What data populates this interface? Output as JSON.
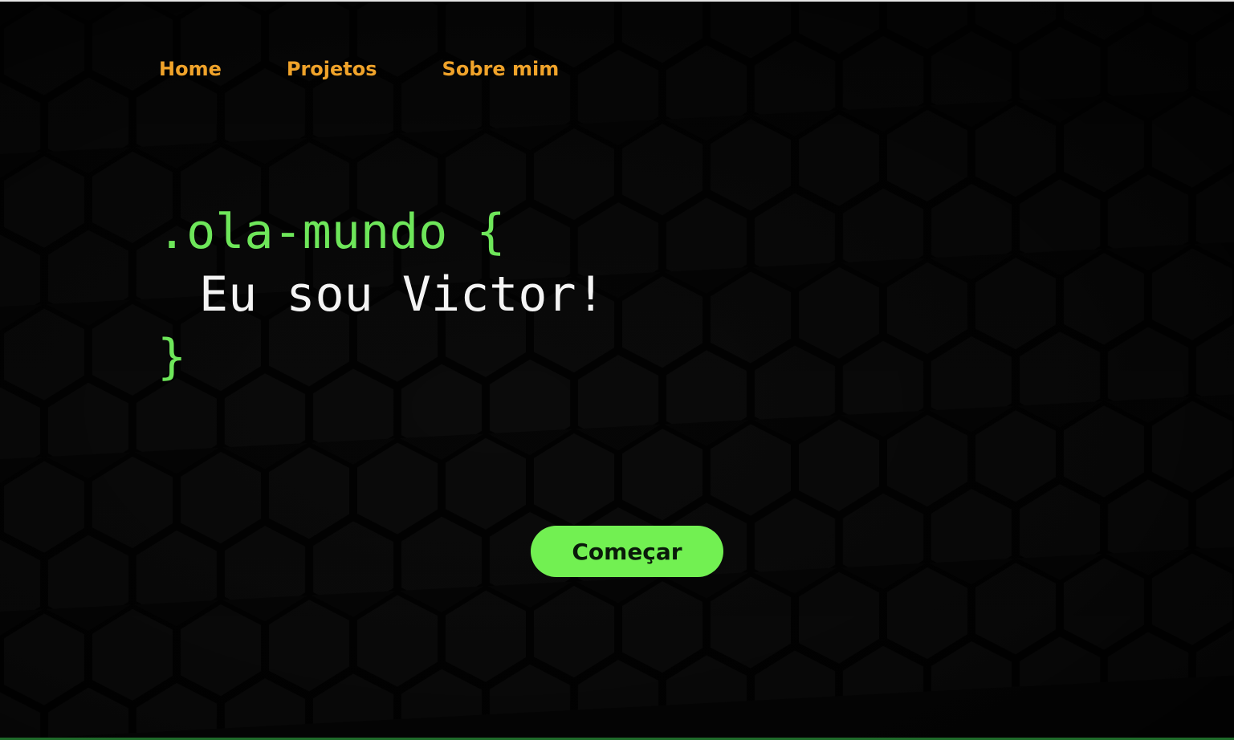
{
  "nav": {
    "items": [
      {
        "label": "Home"
      },
      {
        "label": "Projetos"
      },
      {
        "label": "Sobre mim"
      }
    ]
  },
  "hero": {
    "selector": ".ola-mundo",
    "open_brace": "{",
    "body_text": "Eu sou Victor!",
    "close_brace": "}"
  },
  "cta": {
    "label": "Começar"
  },
  "colors": {
    "background": "#060606",
    "nav_link": "#f0a32a",
    "code_green": "#6ee65a",
    "code_white": "#f4f4f4",
    "button_bg": "#72f052",
    "button_text": "#0a1a0a"
  }
}
